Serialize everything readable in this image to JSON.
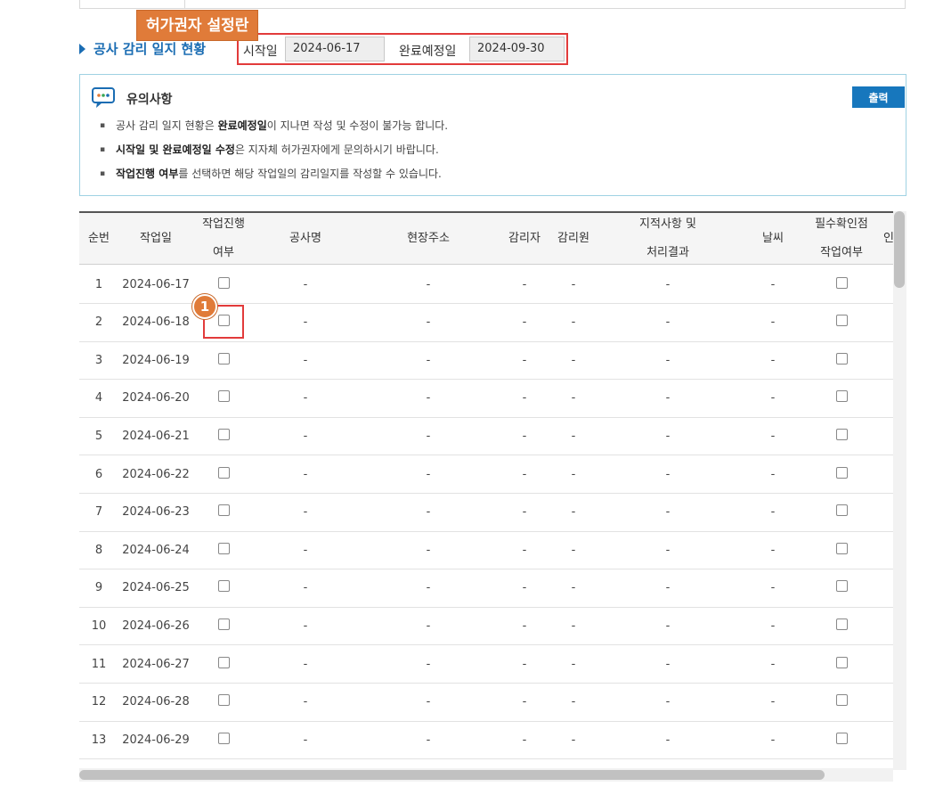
{
  "callout": {
    "label": "허가권자 설정란"
  },
  "section": {
    "title": "공사 감리 일지 현황"
  },
  "period": {
    "start_label": "시작일",
    "start_value": "2024-06-17",
    "end_label": "완료예정일",
    "end_value": "2024-09-30"
  },
  "notice": {
    "title": "유의사항",
    "print_label": "출력",
    "lines": [
      {
        "pre": "공사 감리 일지 현황은 ",
        "bold": "완료예정일",
        "post": "이 지나면 작성 및 수정이 불가능 합니다."
      },
      {
        "pre": "",
        "bold": "시작일 및 완료예정일 수정",
        "post": "은 지자체 허가권자에게 문의하시기 바랍니다."
      },
      {
        "pre": "",
        "bold": "작업진행 여부",
        "post": "를 선택하면 해당 작업일의 감리일지를 작성할 수 있습니다."
      }
    ]
  },
  "table": {
    "headers": [
      [
        "순번"
      ],
      [
        "작업일"
      ],
      [
        "작업진행",
        "여부"
      ],
      [
        "공사명"
      ],
      [
        "현장주소"
      ],
      [
        "감리자"
      ],
      [
        "감리원"
      ],
      [
        "지적사항 및",
        "처리결과"
      ],
      [
        "날씨"
      ],
      [
        "필수확인점",
        "작업여부"
      ],
      [
        "인"
      ]
    ],
    "placeholder": "-",
    "rows": [
      {
        "no": "1",
        "date": "2024-06-17"
      },
      {
        "no": "2",
        "date": "2024-06-18"
      },
      {
        "no": "3",
        "date": "2024-06-19"
      },
      {
        "no": "4",
        "date": "2024-06-20"
      },
      {
        "no": "5",
        "date": "2024-06-21"
      },
      {
        "no": "6",
        "date": "2024-06-22"
      },
      {
        "no": "7",
        "date": "2024-06-23"
      },
      {
        "no": "8",
        "date": "2024-06-24"
      },
      {
        "no": "9",
        "date": "2024-06-25"
      },
      {
        "no": "10",
        "date": "2024-06-26"
      },
      {
        "no": "11",
        "date": "2024-06-27"
      },
      {
        "no": "12",
        "date": "2024-06-28"
      },
      {
        "no": "13",
        "date": "2024-06-29"
      }
    ]
  },
  "marker": {
    "number": "1"
  },
  "icons": {
    "notice": "chat-bubble-icon",
    "section": "triangle-right-icon"
  },
  "colors": {
    "accent": "#1b6db3",
    "callout": "#e07b39",
    "highlight": "#e23b3b",
    "button": "#1777bd"
  }
}
